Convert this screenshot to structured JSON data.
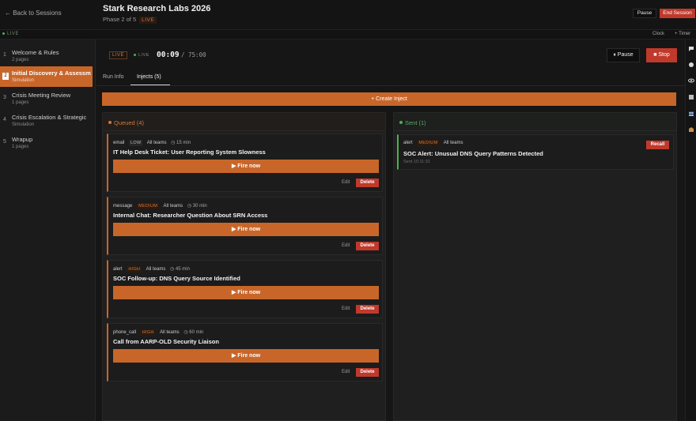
{
  "header": {
    "back_label": "← Back to Sessions",
    "title": "Stark Research Labs 2026",
    "phase": "Phase 2 of 5",
    "live_tag": "LIVE",
    "pause_label": "Pause",
    "end_label": "End Session"
  },
  "subbar": {
    "live_label": "LIVE",
    "clock_label": "Clock",
    "timer_label": "+ Timer"
  },
  "sidebar": {
    "items": [
      {
        "num": "1",
        "name": "Welcome & Rules",
        "sub": "2 pages",
        "active": false
      },
      {
        "num": "2",
        "name": "Initial Discovery & Assessment",
        "sub": "Simulation",
        "active": true
      },
      {
        "num": "3",
        "name": "Crisis Meeting Review",
        "sub": "1 pages",
        "active": false
      },
      {
        "num": "4",
        "name": "Crisis Escalation & Strategic",
        "sub": "Simulation",
        "active": false
      },
      {
        "num": "5",
        "name": "Wrapup",
        "sub": "1 pages",
        "active": false
      }
    ]
  },
  "timer": {
    "live_badge": "LIVE",
    "live_status": "LIVE",
    "elapsed": "00:09",
    "total": "/ 75:00",
    "pause_label": "⏸ Pause",
    "stop_label": "■ Stop"
  },
  "tabs": [
    {
      "label": "Run Info",
      "active": false
    },
    {
      "label": "Injects (5)",
      "active": true
    }
  ],
  "create_label": "+ Create Inject",
  "queued": {
    "header": "Queued (4)",
    "cards": [
      {
        "type": "email",
        "priority": "LOW",
        "teams": "All teams",
        "time": "◷ 15 min",
        "title": "IT Help Desk Ticket: User Reporting System Slowness",
        "fire": "▶ Fire now",
        "edit": "Edit",
        "delete": "Delete"
      },
      {
        "type": "message",
        "priority": "MEDIUM",
        "teams": "All teams",
        "time": "◷ 30 min",
        "title": "Internal Chat: Researcher Question About SRN Access",
        "fire": "▶ Fire now",
        "edit": "Edit",
        "delete": "Delete"
      },
      {
        "type": "alert",
        "priority": "HIGH",
        "teams": "All teams",
        "time": "◷ 45 min",
        "title": "SOC Follow-up: DNS Query Source Identified",
        "fire": "▶ Fire now",
        "edit": "Edit",
        "delete": "Delete"
      },
      {
        "type": "phone_call",
        "priority": "HIGH",
        "teams": "All teams",
        "time": "◷ 60 min",
        "title": "Call from AARP-OLD Security Liaison",
        "fire": "▶ Fire now",
        "edit": "Edit",
        "delete": "Delete"
      }
    ]
  },
  "sent": {
    "header": "Sent (1)",
    "cards": [
      {
        "type": "alert",
        "priority": "MEDIUM",
        "teams": "All teams",
        "title": "SOC Alert: Unusual DNS Query Patterns Detected",
        "sent_at": "Sent 10:11:31",
        "recall": "Recall"
      }
    ]
  },
  "colors": {
    "accent": "#c8662a",
    "danger": "#c0392b",
    "live_green": "#4caf50"
  },
  "rail_icons": [
    "chat-icon",
    "comment-icon",
    "eye-icon",
    "notes-icon",
    "team-icon",
    "badge-icon"
  ]
}
